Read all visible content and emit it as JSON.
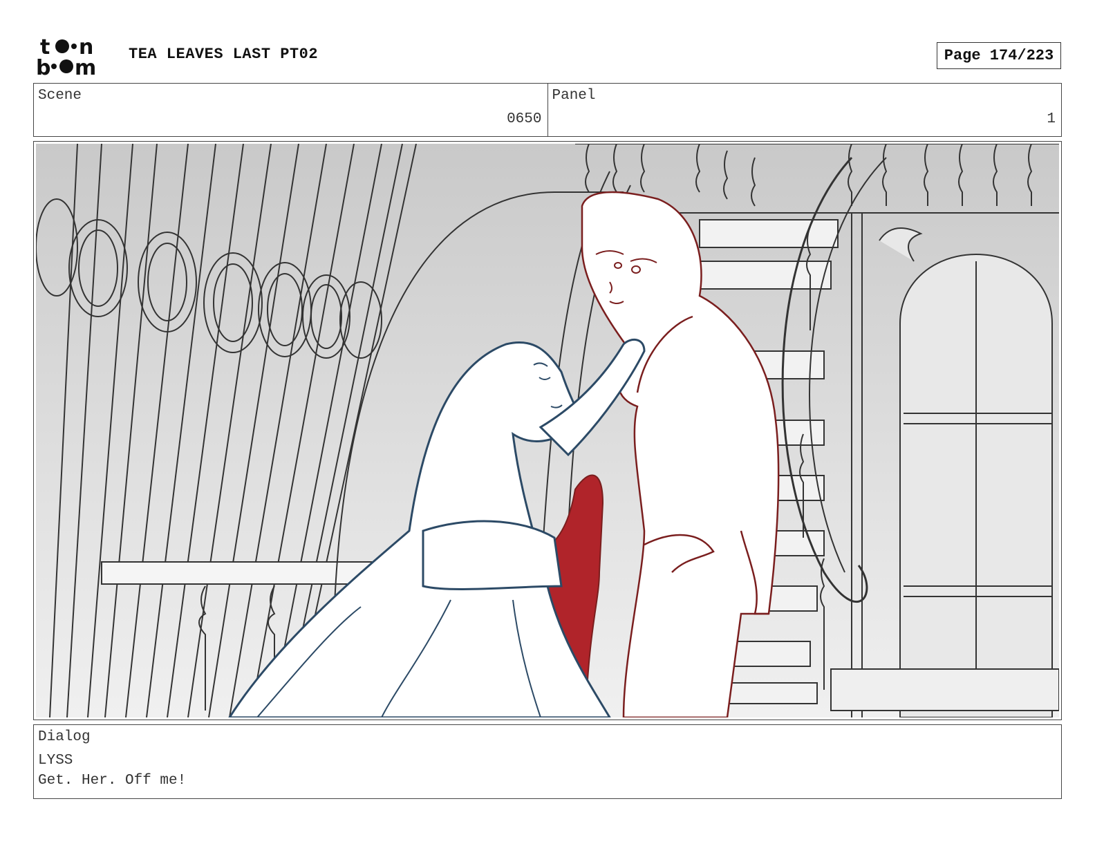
{
  "header": {
    "logo_text": "toon boom",
    "project_title": "TEA LEAVES LAST PT02",
    "page_label": "Page 174/223"
  },
  "scene": {
    "label": "Scene",
    "value": "0650"
  },
  "panel": {
    "label": "Panel",
    "value": "1"
  },
  "dialog": {
    "label": "Dialog",
    "speaker": "LYSS",
    "line": "Get. Her. Off me!"
  },
  "colors": {
    "accent_red": "#b0242a",
    "line_blue": "#2c4a66",
    "line_dark_red": "#7a1e1e",
    "background_gray": "#d9d9d9"
  }
}
